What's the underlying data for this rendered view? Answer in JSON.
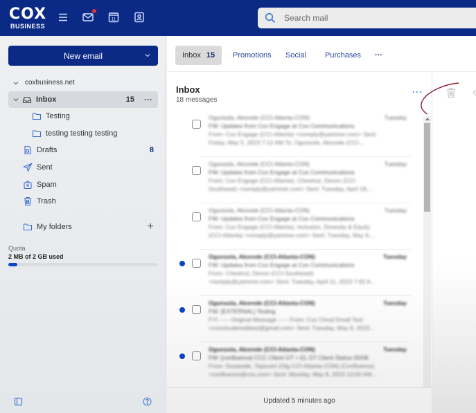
{
  "header": {
    "logo_main": "COX",
    "logo_sub": "BUSINESS",
    "icons": [
      "menu-icon",
      "mail-icon",
      "calendar-icon",
      "contacts-icon"
    ],
    "calendar_day": "11",
    "search_placeholder": "Search mail"
  },
  "sidebar": {
    "new_email_label": "New email",
    "account": "coxbusiness.net",
    "folders": [
      {
        "label": "Inbox",
        "count": "15",
        "more": "···",
        "icon": "inbox-icon"
      },
      {
        "label": "Testing",
        "icon": "folder-icon"
      },
      {
        "label": "testing testing testing",
        "icon": "folder-icon"
      },
      {
        "label": "Drafts",
        "count": "8",
        "icon": "drafts-icon"
      },
      {
        "label": "Sent",
        "icon": "sent-icon"
      },
      {
        "label": "Spam",
        "icon": "spam-icon"
      },
      {
        "label": "Trash",
        "icon": "trash-icon"
      }
    ],
    "my_folders_label": "My folders",
    "add_folder": "+",
    "quota_label": "Quota",
    "quota_used": "2 MB of 2 GB used",
    "quota_fraction": 0.06
  },
  "tabs": [
    {
      "label": "Inbox",
      "count": "15",
      "active": true
    },
    {
      "label": "Promotions"
    },
    {
      "label": "Social"
    },
    {
      "label": "Purchases"
    },
    {
      "label": "···"
    }
  ],
  "list": {
    "title": "Inbox",
    "subtitle": "18 messages",
    "more": "···",
    "messages": [
      {
        "sender": "Ogunsola, Akorede (CCI-Atlanta-CON)",
        "date": "Tuesday",
        "subject": "FW: Updates from Cox Engage at Cox Communications",
        "preview1": "From: Cox Engage (CCI-Atlanta) <noreply@yammer.com> Sent:",
        "preview2": "Friday, May 5, 2023 7:12 AM To: Ogunsola, Akorede (CCI-...",
        "unread": false
      },
      {
        "sender": "Ogunsola, Akorede (CCI-Atlanta-CON)",
        "date": "Tuesday",
        "subject": "FW: Updates from Cox Engage at Cox Communications",
        "preview1": "From: Cox Engage (CCI-Atlanta), Chestnut, Devon (CCI-",
        "preview2": "Southeast) <noreply@yammer.com> Sent: Tuesday, April 18,...",
        "unread": false
      },
      {
        "sender": "Ogunsola, Akorede (CCI-Atlanta-CON)",
        "date": "Tuesday",
        "subject": "FW: Updates from Cox Engage at Cox Communications",
        "preview1": "From: Cox Engage (CCI-Atlanta), Inclusion, Diversity & Equity",
        "preview2": "(CCI-Atlanta) <noreply@yammer.com> Sent: Tuesday, May 9,...",
        "unread": false
      },
      {
        "sender": "Ogunsola, Akorede (CCI-Atlanta-CON)",
        "date": "Tuesday",
        "subject": "FW: Updates from Cox Engage at Cox Communications",
        "preview1": "From: Chestnut, Devon (CCI-Southeast)",
        "preview2": "<noreply@yammer.com> Sent: Tuesday, April 11, 2023 7:42 A...",
        "unread": true
      },
      {
        "sender": "Ogunsola, Akorede (CCI-Atlanta-CON)",
        "date": "Tuesday",
        "subject": "FW: [EXTERNAL] Testing",
        "preview1": "FYI ----- Original Message ----- From: Cox Cloud Email Test",
        "preview2": "<coxcloudemailtest@gmail.com> Sent: Tuesday, May 9, 2023...",
        "unread": true
      },
      {
        "sender": "Ogunsola, Akorede (CCI-Atlanta-CON)",
        "date": "Tuesday",
        "subject": "FW: [confluence] CCC Client GT > EL GT Client Status 05/08",
        "preview1": "From: Sosawale, Tejasvini (Olg-CCI-Atlanta-CON) (Confluence)",
        "preview2": "<confluence@cox.com> Sent: Monday, May 8, 2023 10:00 AM...",
        "unread": true
      }
    ],
    "footer": "Updated 5 minutes ago"
  },
  "colors": {
    "brand": "#0b2a86",
    "accent": "#0b44c8",
    "link": "#2b4a9c",
    "annotation": "#8b1a2b"
  }
}
